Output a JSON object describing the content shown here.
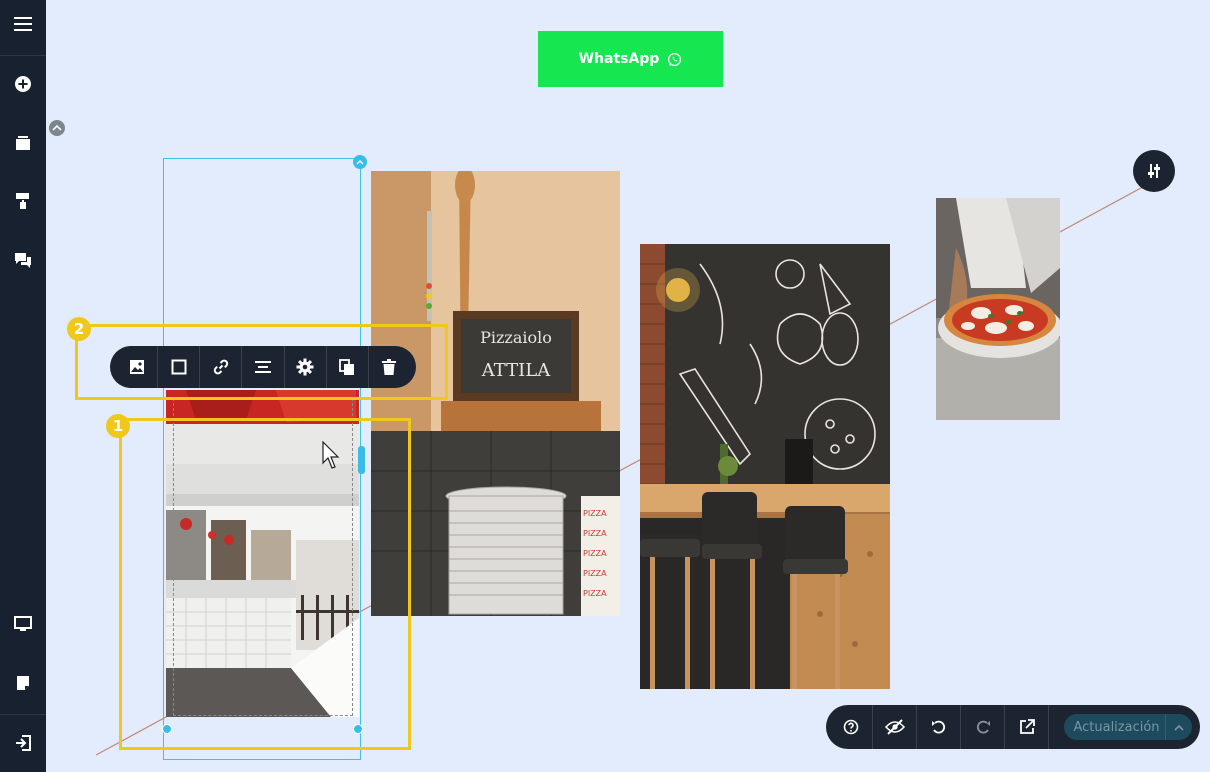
{
  "whatsapp_button": {
    "label": "WhatsApp"
  },
  "sidebar": {
    "top_items": [
      {
        "icon": "menu-icon"
      },
      {
        "icon": "add-circle-icon"
      },
      {
        "icon": "layers-icon"
      },
      {
        "icon": "paint-roller-icon"
      },
      {
        "icon": "chat-icon"
      }
    ],
    "bottom_items": [
      {
        "icon": "desktop-icon"
      },
      {
        "icon": "page-icon"
      },
      {
        "icon": "exit-icon"
      }
    ]
  },
  "image_toolbar": {
    "items": [
      "image-icon",
      "frame-icon",
      "link-icon",
      "align-icon",
      "gear-icon",
      "duplicate-icon",
      "trash-icon"
    ]
  },
  "annotations": [
    {
      "number": "1"
    },
    {
      "number": "2"
    }
  ],
  "bottom_bar": {
    "items": [
      "help-icon",
      "eye-off-icon",
      "undo-icon",
      "redo-icon",
      "external-link-icon"
    ],
    "update_label": "Actualización"
  },
  "colors": {
    "canvas": "#e2ecfc",
    "sidebar": "#172130",
    "whatsapp": "#16e650",
    "selection": "#3dc2e8",
    "highlight": "#f0c81c",
    "update_pill": "#1e4a5e"
  },
  "images": [
    {
      "description": "restaurant interior with white tiled counter"
    },
    {
      "description": "Pizzaiolo Attila chalkboard with stacked plates"
    },
    {
      "description": "chalkboard wall with bar stools"
    },
    {
      "description": "margherita pizza on plate"
    }
  ],
  "images_alt": {}
}
